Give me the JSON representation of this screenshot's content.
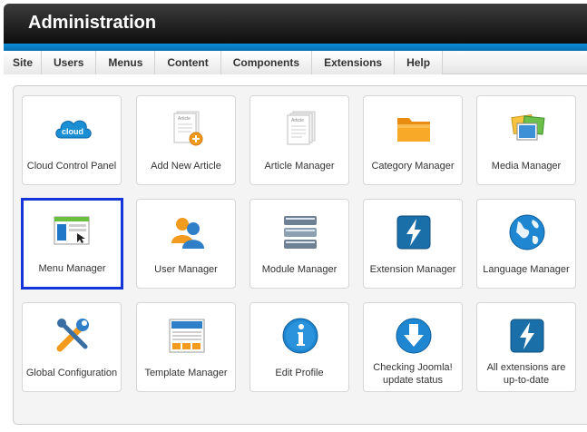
{
  "header": {
    "title": "Administration"
  },
  "menu": {
    "items": [
      "Site",
      "Users",
      "Menus",
      "Content",
      "Components",
      "Extensions",
      "Help"
    ]
  },
  "tiles": [
    {
      "label": "Cloud Control Panel",
      "icon": "cloud-icon",
      "badge": "cloud"
    },
    {
      "label": "Add New Article",
      "icon": "add-article-icon",
      "doc_text": "Article"
    },
    {
      "label": "Article Manager",
      "icon": "article-icon",
      "doc_text": "Article"
    },
    {
      "label": "Category Manager",
      "icon": "folder-icon"
    },
    {
      "label": "Media Manager",
      "icon": "media-icon"
    },
    {
      "label": "Menu Manager",
      "icon": "menu-icon"
    },
    {
      "label": "User Manager",
      "icon": "users-icon"
    },
    {
      "label": "Module Manager",
      "icon": "modules-icon"
    },
    {
      "label": "Extension Manager",
      "icon": "extension-icon"
    },
    {
      "label": "Language Manager",
      "icon": "globe-icon"
    },
    {
      "label": "Global Configuration",
      "icon": "tools-icon"
    },
    {
      "label": "Template Manager",
      "icon": "template-icon"
    },
    {
      "label": "Edit Profile",
      "icon": "info-icon"
    },
    {
      "label": "Checking Joomla! update status",
      "icon": "download-icon"
    },
    {
      "label": "All extensions are up-to-date",
      "icon": "extension-update-icon"
    }
  ],
  "colors": {
    "accent_blue": "#0b8ed6",
    "selection_border": "#1436d8"
  }
}
